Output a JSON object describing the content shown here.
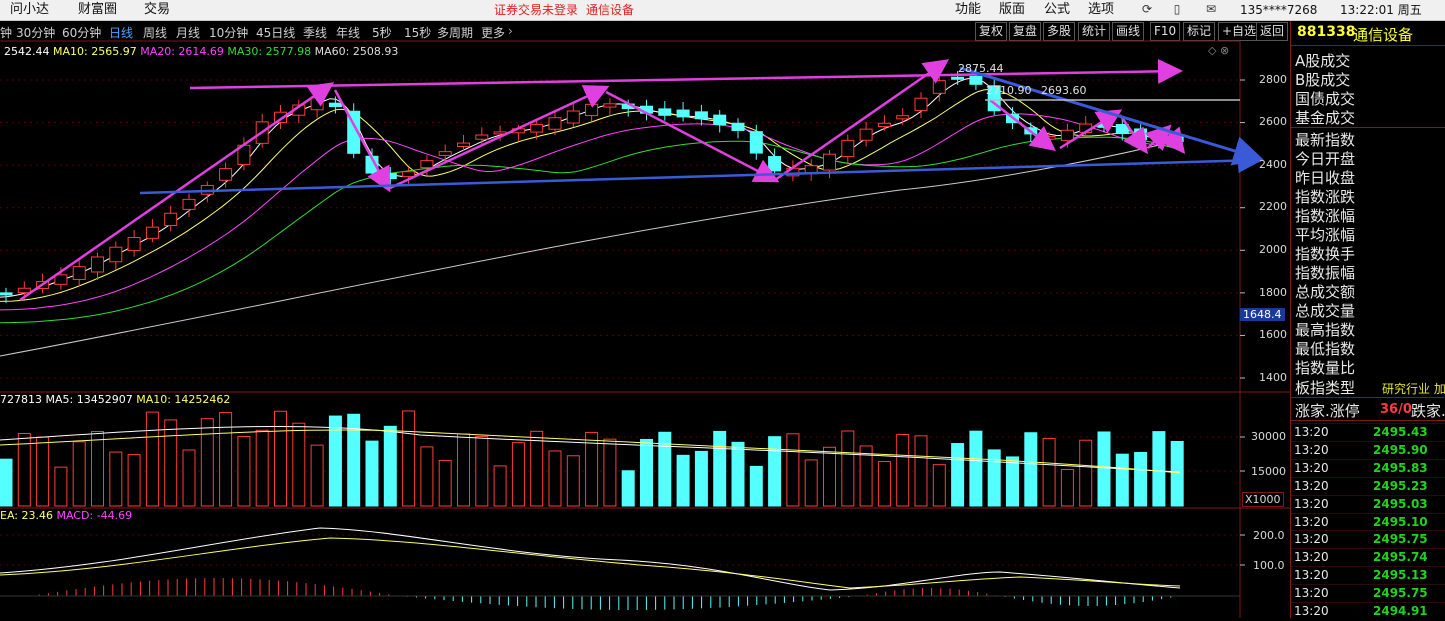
{
  "topbar": {
    "left_menu": [
      "问小达",
      "财富圈",
      "交易"
    ],
    "status": "证券交易未登录",
    "stock_name": "通信设备",
    "right_menu": [
      "功能",
      "版面",
      "公式",
      "选项"
    ],
    "account": "135****7268",
    "clock": "13:22:01 周五"
  },
  "periods": [
    "钟",
    "30分钟",
    "60分钟",
    "日线",
    "周线",
    "月线",
    "10分钟",
    "45日线",
    "季线",
    "年线",
    "5秒",
    "15秒",
    "多周期",
    "更多"
  ],
  "active_period": "日线",
  "tools": [
    "复权",
    "复盘",
    "多股",
    "统计",
    "画线",
    "F10",
    "标记",
    "+自选",
    "返回"
  ],
  "main_legend": {
    "ma5": "2542.44",
    "ma10": "MA10: 2565.97",
    "ma20": "MA20: 2614.69",
    "ma30": "MA30: 2577.98",
    "ma60": "MA60: 2508.93"
  },
  "annotations": {
    "high": "2875.44",
    "label2": "2710.90",
    "label3": "2693.60"
  },
  "price_axis": [
    "2800",
    "2600",
    "2400",
    "2200",
    "2000",
    "1800",
    "1600",
    "1400"
  ],
  "price_marker": "1648.4",
  "volume_legend": {
    "vol": "727813",
    "ma5": "MA5: 13452907",
    "ma10": "MA10: 14252462"
  },
  "volume_axis": [
    "30000",
    "15000"
  ],
  "volume_unit": "X1000",
  "macd_legend": {
    "dea": "EA: 23.46",
    "macd": "MACD: -44.69"
  },
  "macd_axis": [
    "200.0",
    "100.0"
  ],
  "right_panel": {
    "code": "881338",
    "name": "通信设备",
    "fields": [
      "A股成交",
      "B股成交",
      "国债成交",
      "基金成交",
      "最新指数",
      "今日开盘",
      "昨日收盘",
      "指数涨跌",
      "指数涨幅",
      "平均涨幅",
      "指数换手",
      "指数振幅",
      "总成交额",
      "总成交量",
      "最高指数",
      "最低指数",
      "指数量比"
    ],
    "board_label": "板指类型",
    "board_value": "研究行业 加",
    "updown_label": "涨家.涨停",
    "updown_value": "36/0",
    "down_label": "跌家.",
    "ticks": [
      {
        "time": "13:20",
        "price": "2495.43"
      },
      {
        "time": "13:20",
        "price": "2495.90"
      },
      {
        "time": "13:20",
        "price": "2495.83"
      },
      {
        "time": "13:20",
        "price": "2495.23"
      },
      {
        "time": "13:20",
        "price": "2495.03"
      },
      {
        "time": "13:20",
        "price": "2495.10"
      },
      {
        "time": "13:20",
        "price": "2495.75"
      },
      {
        "time": "13:20",
        "price": "2495.74"
      },
      {
        "time": "13:20",
        "price": "2495.13"
      },
      {
        "time": "13:20",
        "price": "2495.75"
      },
      {
        "time": "13:20",
        "price": "2494.91"
      }
    ]
  },
  "colors": {
    "up": "#ff3b3b",
    "down": "#54ffff",
    "ma5": "#ffffff",
    "ma10": "#ffff66",
    "ma20": "#ff44ff",
    "ma30": "#33dd33",
    "ma60": "#cccccc",
    "trend_magenta": "#e040e0",
    "trend_blue": "#3a5ad8",
    "active_tab": "#4aa3ff",
    "ticks_green": "#1fd31f"
  }
}
